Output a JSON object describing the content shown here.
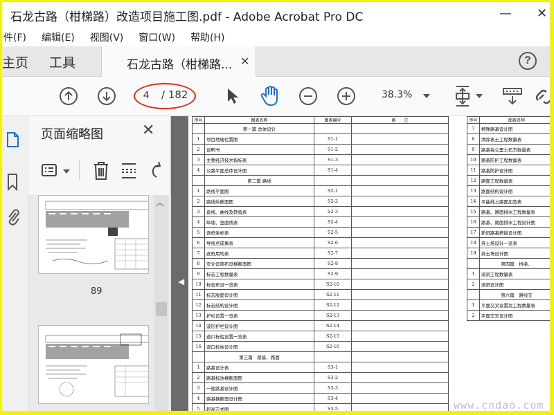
{
  "window": {
    "title": "石龙古路（柑梯路）改造项目施工图.pdf - Adobe Acrobat Pro DC"
  },
  "menu": [
    "件(F)",
    "编辑(E)",
    "视图(V)",
    "窗口(W)",
    "帮助(H)"
  ],
  "tabs": {
    "home": "主页",
    "tools": "工具",
    "doc": "石龙古路（柑梯路..."
  },
  "help_label": "?",
  "toolbar": {
    "page_current": "4",
    "page_total": "/ 182",
    "zoom": "38.3%"
  },
  "thumbnails_panel": {
    "title": "页面缩略图",
    "thumb_label_1": "89"
  },
  "document": {
    "headers": {
      "seq": "序号",
      "name": "图表名称",
      "code": "图表编号",
      "remark": "备　　注"
    },
    "rows": [
      {
        "type": "section",
        "name": "第一篇  总体设计"
      },
      {
        "seq": "1",
        "name": "项目地理位置图",
        "code": "S1-1"
      },
      {
        "seq": "2",
        "name": "说明书",
        "code": "S1-2"
      },
      {
        "seq": "3",
        "name": "主要经济技术指标表",
        "code": "S1-3"
      },
      {
        "seq": "4",
        "name": "公路平面总体设计图",
        "code": "S1-4"
      },
      {
        "type": "section",
        "name": "第二篇  路线"
      },
      {
        "seq": "1",
        "name": "路线平面图",
        "code": "S2-1"
      },
      {
        "seq": "2",
        "name": "路线纵断面图",
        "code": "S2-2"
      },
      {
        "seq": "3",
        "name": "直线、曲线及转角表",
        "code": "S2-3"
      },
      {
        "seq": "4",
        "name": "纵坡、竖曲线表",
        "code": "S2-4"
      },
      {
        "seq": "5",
        "name": "逐桩坐标表",
        "code": "S2-5"
      },
      {
        "seq": "6",
        "name": "导线点成果表",
        "code": "S2-6"
      },
      {
        "seq": "7",
        "name": "逐桩用地表",
        "code": "S2-7"
      },
      {
        "seq": "8",
        "name": "安全设施布设横断面图",
        "code": "S2-8"
      },
      {
        "seq": "9",
        "name": "标志工程数量表",
        "code": "S2-9"
      },
      {
        "seq": "10",
        "name": "标志布设一览表",
        "code": "S2-10"
      },
      {
        "seq": "11",
        "name": "标志版面设计图",
        "code": "S2-11"
      },
      {
        "seq": "12",
        "name": "标志结构设计图",
        "code": "S2-12"
      },
      {
        "seq": "13",
        "name": "护栏设置一览表",
        "code": "S2-13"
      },
      {
        "seq": "14",
        "name": "波形护栏设计图",
        "code": "S2-14"
      },
      {
        "seq": "15",
        "name": "道口标柱设置一览表",
        "code": "S2-15"
      },
      {
        "seq": "16",
        "name": "道口标柱设计图",
        "code": "S2-16"
      },
      {
        "type": "section",
        "name": "第三篇　路基、路面"
      },
      {
        "seq": "1",
        "name": "路基设计表",
        "code": "S3-1"
      },
      {
        "seq": "2",
        "name": "路基标准横断面图",
        "code": "S3-2"
      },
      {
        "seq": "3",
        "name": "一般路基设计图",
        "code": "S3-3"
      },
      {
        "seq": "4",
        "name": "路基横断面设计图",
        "code": "S3-4"
      },
      {
        "seq": "5",
        "name": "超高方式图",
        "code": "S3-5"
      }
    ],
    "right_rows": [
      {
        "seq": "7",
        "name": "特殊路基设计图"
      },
      {
        "seq": "8",
        "name": "清除表土工程数量表"
      },
      {
        "seq": "9",
        "name": "路基每公里土石方数量表"
      },
      {
        "seq": "10",
        "name": "路基防护工程数量表"
      },
      {
        "seq": "11",
        "name": "路基防护设计图"
      },
      {
        "seq": "12",
        "name": "路面工程数量表"
      },
      {
        "seq": "13",
        "name": "路面结构设计图"
      },
      {
        "seq": "14",
        "name": "平曲线上路面加宽表"
      },
      {
        "seq": "15",
        "name": "路基、路面排水工程数量表"
      },
      {
        "seq": "16",
        "name": "路基、路面排水工程设计图"
      },
      {
        "seq": "17",
        "name": "新旧路基搭接设计图"
      },
      {
        "seq": "18",
        "name": "弃土场设计一览表"
      },
      {
        "seq": "19",
        "name": "弃土场设计图"
      },
      {
        "type": "section",
        "name": "第四篇　桥梁、"
      },
      {
        "seq": "1",
        "name": "涵洞工程数量表"
      },
      {
        "seq": "2",
        "name": "涵洞设计图"
      },
      {
        "type": "section",
        "name": "第六篇　路线交"
      },
      {
        "seq": "1",
        "name": "平面交叉设置及工程数量表"
      },
      {
        "seq": "2",
        "name": "平面交叉设计图"
      }
    ]
  },
  "watermark": "www.cndao.com"
}
